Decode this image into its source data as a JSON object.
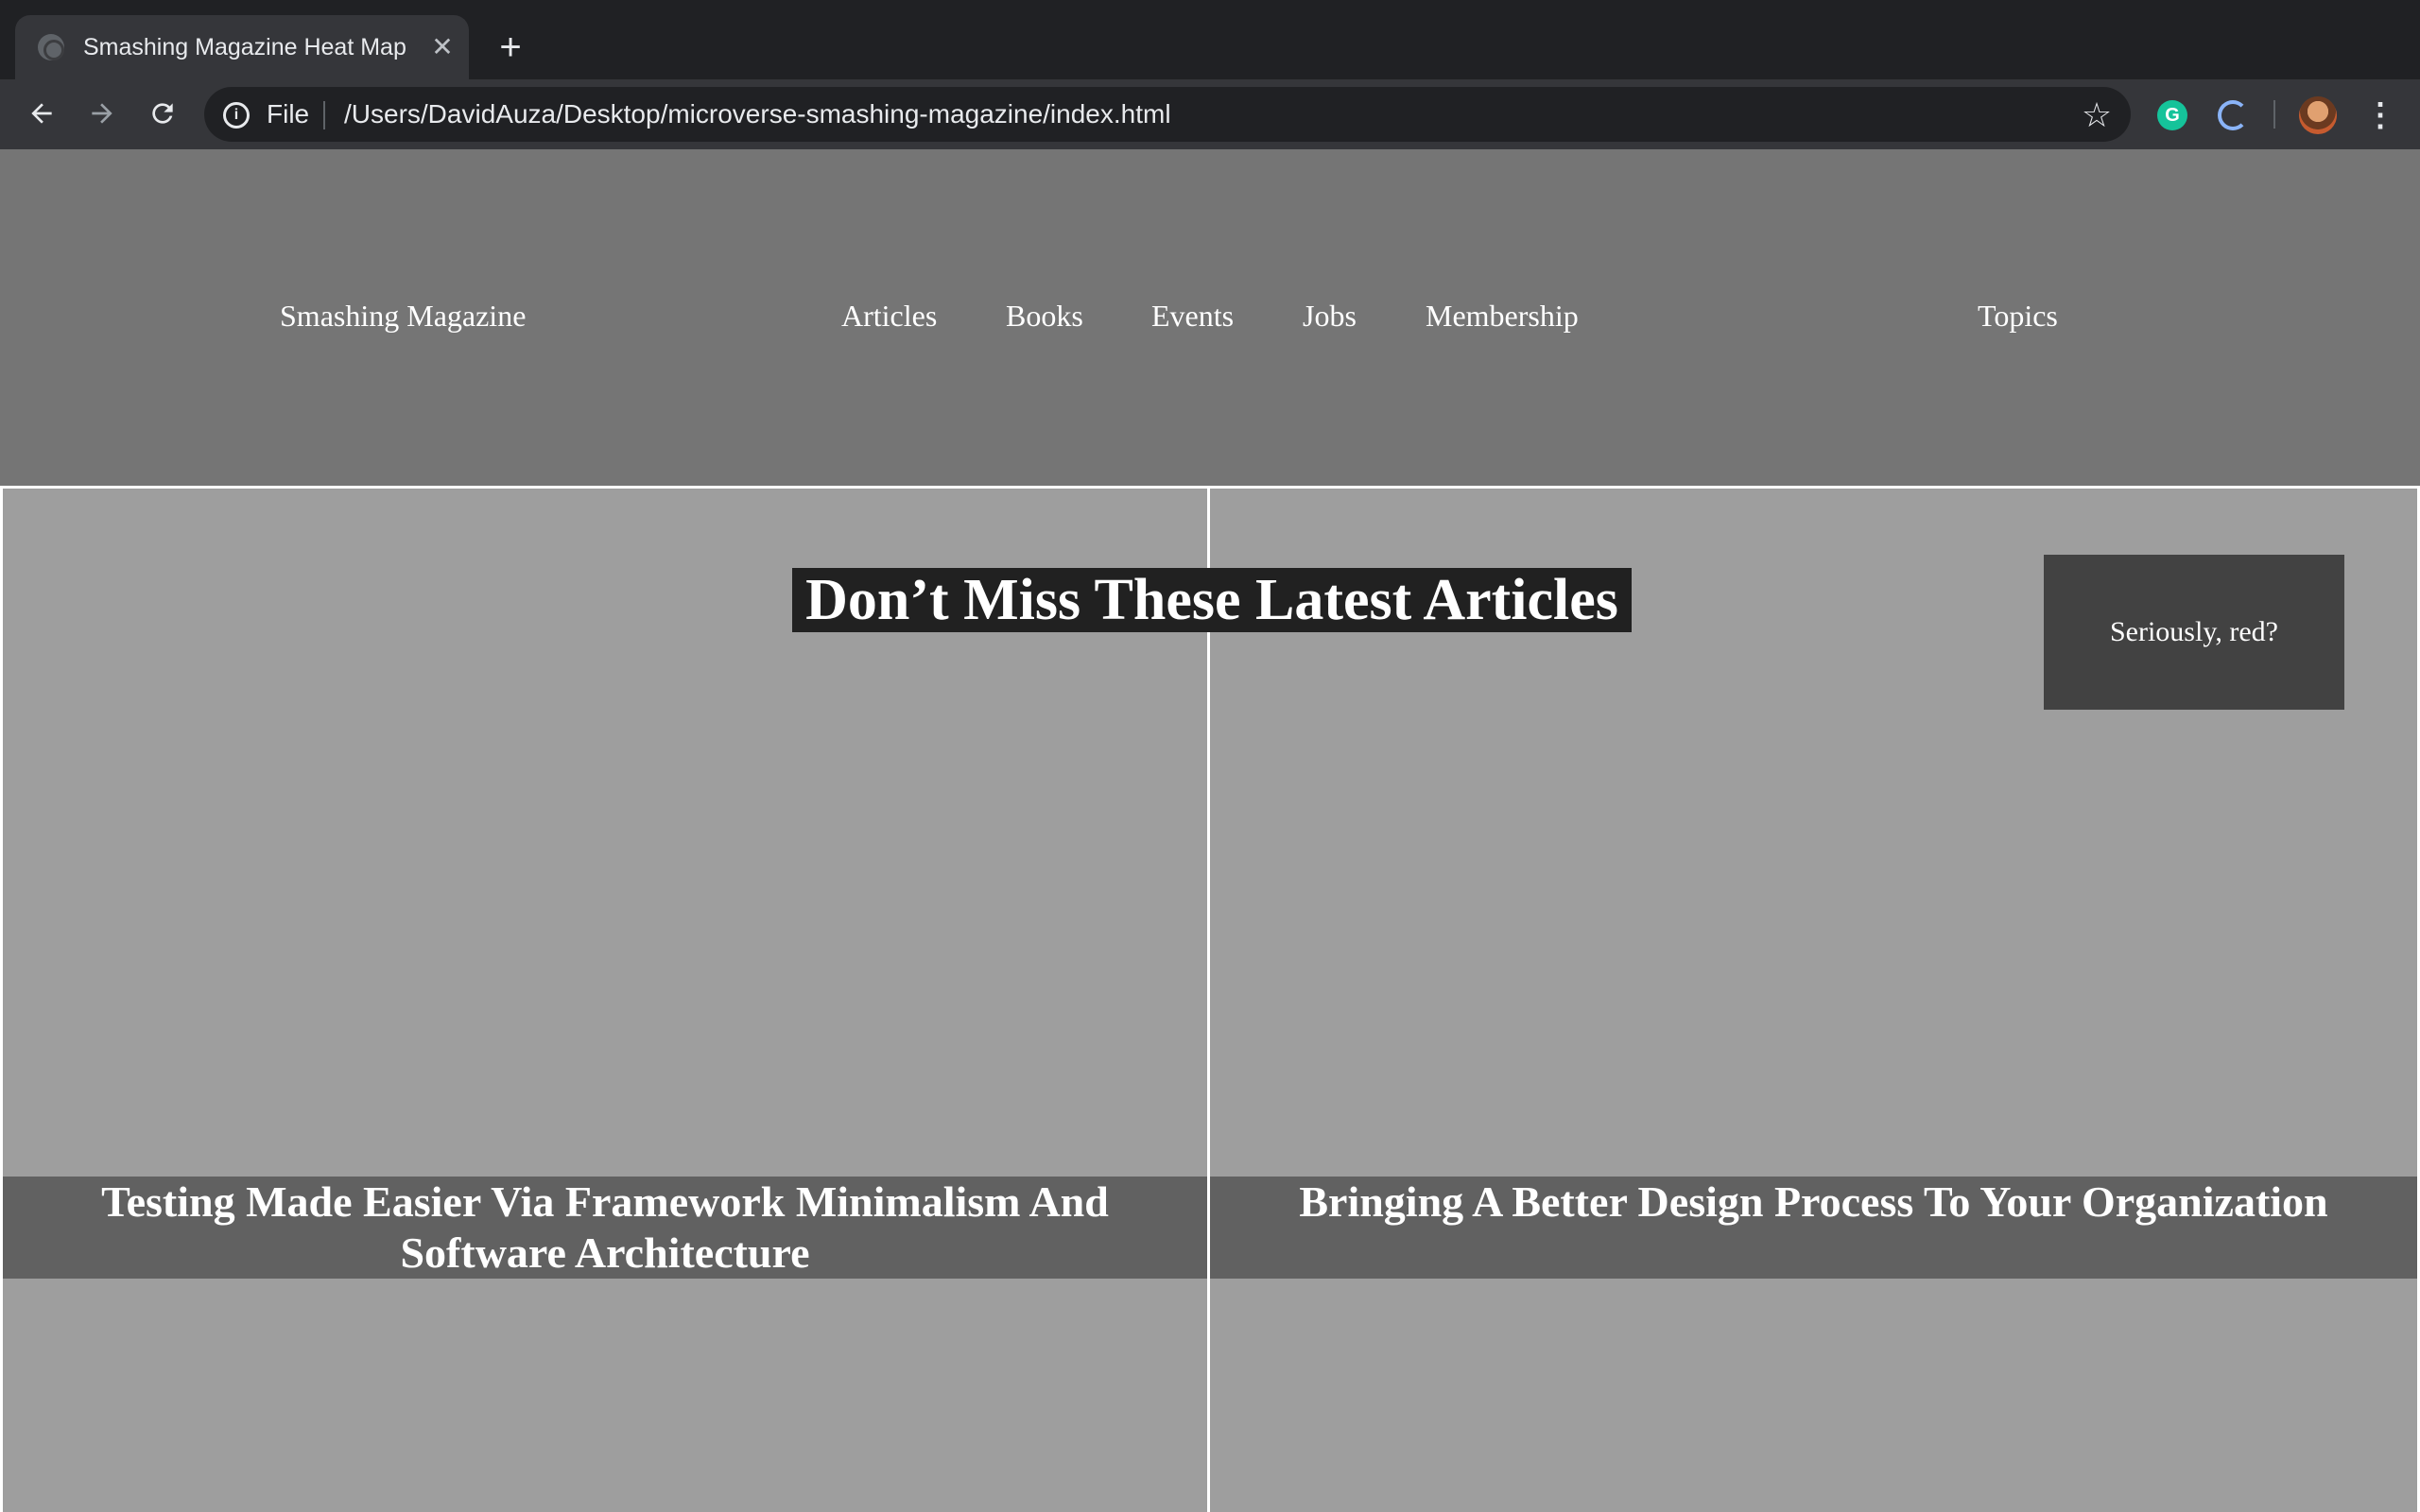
{
  "browser": {
    "tab": {
      "title": "Smashing Magazine Heat Map",
      "close_glyph": "✕",
      "favicon": "globe-icon"
    },
    "new_tab_glyph": "+",
    "toolbar": {
      "back_icon": "back-arrow-icon",
      "forward_icon": "forward-arrow-icon",
      "reload_icon": "reload-icon",
      "omnibox": {
        "scheme_label": "File",
        "info_glyph": "i",
        "url": "/Users/DavidAuza/Desktop/microverse-smashing-magazine/index.html"
      },
      "star_glyph": "☆",
      "grammarly_glyph": "G",
      "menu_glyph": "⋮"
    }
  },
  "site": {
    "logo": "Smashing Magazine",
    "nav": [
      {
        "label": "Articles"
      },
      {
        "label": "Books"
      },
      {
        "label": "Events"
      },
      {
        "label": "Jobs"
      },
      {
        "label": "Membership"
      },
      {
        "label": "Topics"
      }
    ]
  },
  "main": {
    "headline": "Don’t Miss These Latest Articles",
    "alert_button": "Seriously, red?",
    "articles": [
      {
        "title": "Testing Made Easier Via Framework Minimalism And Software Architecture"
      },
      {
        "title": "Bringing A Better Design Process To Your Organization"
      }
    ]
  },
  "colors": {
    "header_bg": "#757575",
    "panel_bg": "#9e9e9e",
    "caption_bg": "#616161",
    "headline_bg": "#212121",
    "alert_bg": "#424242"
  }
}
